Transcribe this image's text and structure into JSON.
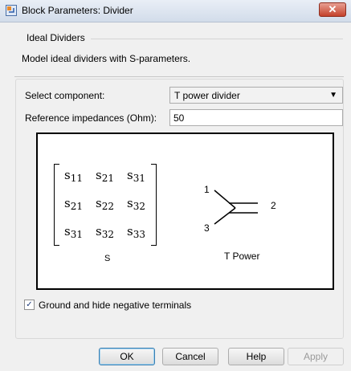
{
  "window": {
    "title": "Block Parameters: Divider",
    "close_glyph": "✕"
  },
  "header": {
    "group_title": "Ideal Dividers",
    "description": "Model ideal dividers with S-parameters."
  },
  "params": {
    "component_label": "Select component:",
    "component_value": "T power divider",
    "impedance_label": "Reference impedances (Ohm):",
    "impedance_value": "50"
  },
  "figure": {
    "matrix": [
      [
        "s",
        "11"
      ],
      [
        "s",
        "21"
      ],
      [
        "s",
        "31"
      ],
      [
        "s",
        "21"
      ],
      [
        "s",
        "22"
      ],
      [
        "s",
        "32"
      ],
      [
        "s",
        "31"
      ],
      [
        "s",
        "32"
      ],
      [
        "s",
        "33"
      ]
    ],
    "matrix_label": "S",
    "device_label": "T Power",
    "ports": [
      "1",
      "2",
      "3"
    ]
  },
  "options": {
    "ground_label": "Ground and hide negative terminals",
    "ground_checked": true
  },
  "buttons": {
    "ok": "OK",
    "cancel": "Cancel",
    "help": "Help",
    "apply": "Apply"
  },
  "icons": {
    "app": "simulink-block-icon",
    "close": "close-icon",
    "dropdown": "chevron-down-icon"
  }
}
